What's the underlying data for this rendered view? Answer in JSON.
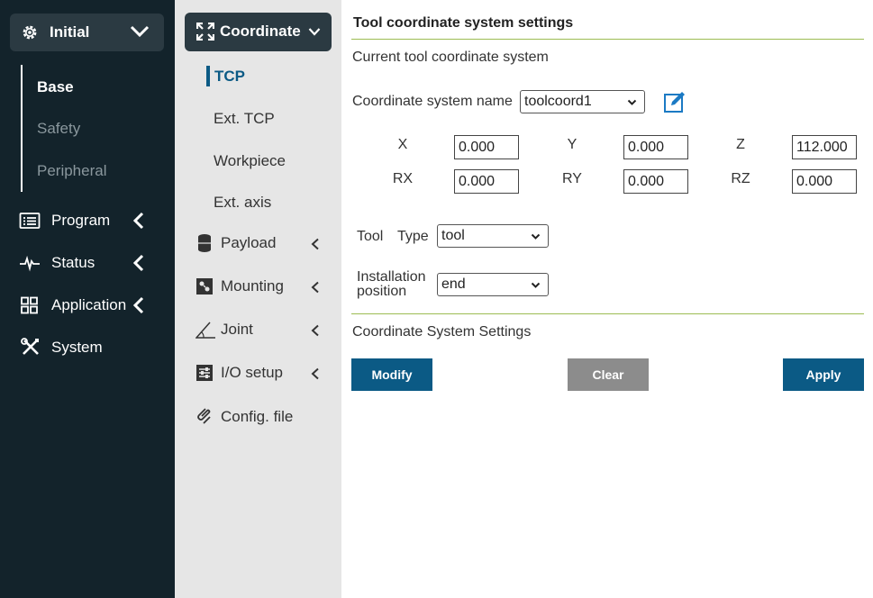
{
  "sidebar": {
    "initial_label": "Initial",
    "sub_items": [
      "Base",
      "Safety",
      "Peripheral"
    ],
    "active_sub": "Base",
    "items": [
      {
        "label": "Program",
        "icon": "list-icon"
      },
      {
        "label": "Status",
        "icon": "pulse-icon"
      },
      {
        "label": "Application",
        "icon": "grid-icon"
      },
      {
        "label": "System",
        "icon": "tools-icon"
      }
    ]
  },
  "midnav": {
    "coordinate_label": "Coordinate",
    "sub_items": [
      "TCP",
      "Ext. TCP",
      "Workpiece",
      "Ext. axis"
    ],
    "active_sub": "TCP",
    "items": [
      {
        "label": "Payload",
        "icon": "payload-icon"
      },
      {
        "label": "Mounting",
        "icon": "mounting-icon"
      },
      {
        "label": "Joint",
        "icon": "joint-angle-icon"
      },
      {
        "label": "I/O setup",
        "icon": "io-setup-icon"
      },
      {
        "label": "Config. file",
        "icon": "config-file-icon"
      }
    ]
  },
  "main": {
    "title": "Tool coordinate system settings",
    "current_label": "Current tool coordinate system",
    "coord_name_label": "Coordinate system name",
    "coord_name_value": "toolcoord1",
    "axes": {
      "x": {
        "label": "X",
        "value": "0.000"
      },
      "y": {
        "label": "Y",
        "value": "0.000"
      },
      "z": {
        "label": "Z",
        "value": "112.000"
      },
      "rx": {
        "label": "RX",
        "value": "0.000"
      },
      "ry": {
        "label": "RY",
        "value": "0.000"
      },
      "rz": {
        "label": "RZ",
        "value": "0.000"
      }
    },
    "tool_label_1": "Tool",
    "tool_label_2": "Type",
    "tool_type_value": "tool",
    "install_label_1": "Installation",
    "install_label_2": "position",
    "install_value": "end",
    "settings_label": "Coordinate System Settings",
    "buttons": {
      "modify": "Modify",
      "clear": "Clear",
      "apply": "Apply"
    }
  },
  "colors": {
    "sidebar_bg": "#13232b",
    "panel_btn_bg": "#2b3a42",
    "accent_blue": "#0b5a85",
    "clear_gray": "#8c8c8c",
    "divider_green": "#9cbc52",
    "midcol_bg": "#e6e6e6"
  }
}
